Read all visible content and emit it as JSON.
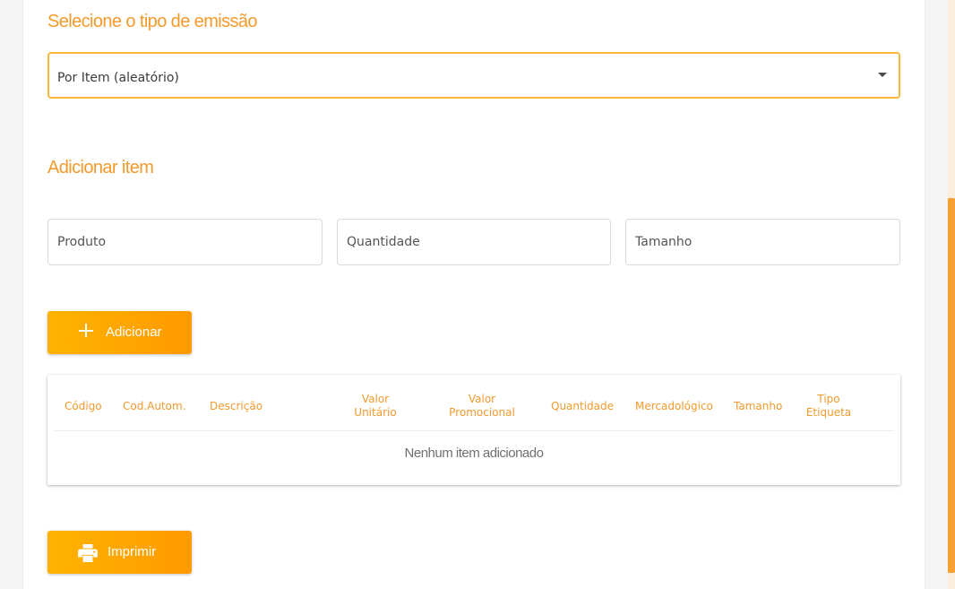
{
  "emission": {
    "title": "Selecione o tipo de emissão",
    "selected": "Por Item (aleatório)"
  },
  "add_item": {
    "title": "Adicionar item",
    "produto_placeholder": "Produto",
    "quantidade_placeholder": "Quantidade",
    "tamanho_placeholder": "Tamanho",
    "add_button_label": "Adicionar",
    "add_button_icon": "plus-icon"
  },
  "table": {
    "columns": [
      {
        "label": "Código"
      },
      {
        "label": "Cod.Autom."
      },
      {
        "label": "Descrição"
      },
      {
        "line1": "Valor",
        "line2": "Unitário"
      },
      {
        "line1": "Valor",
        "line2": "Promocional"
      },
      {
        "label": "Quantidade"
      },
      {
        "label": "Mercadológico"
      },
      {
        "label": "Tamanho"
      },
      {
        "line1": "Tipo",
        "line2": "Etiqueta"
      }
    ],
    "empty_message": "Nenhum item adicionado"
  },
  "print": {
    "label": "Imprimir",
    "icon": "printer-icon"
  },
  "colors": {
    "accent": "#f39a2b",
    "button_gradient_start": "#ffb300",
    "button_gradient_end": "#ff9a00",
    "scrollbar": "#f7a134"
  }
}
